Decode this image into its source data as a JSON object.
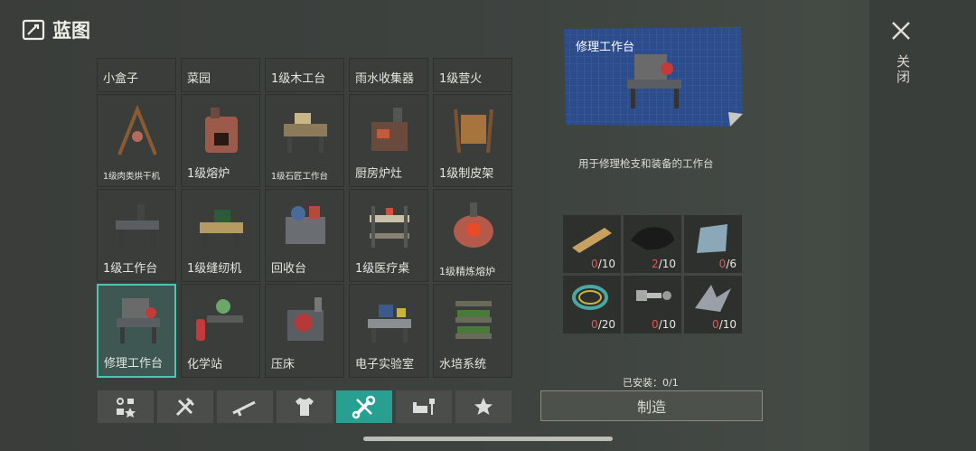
{
  "header": {
    "title": "蓝图"
  },
  "grid": {
    "top_row": [
      "小盒子",
      "菜园",
      "1级木工台",
      "雨水收集器",
      "1级营火"
    ],
    "rows": [
      [
        "1级肉类烘干机",
        "1级熔炉",
        "1级石匠工作台",
        "厨房炉灶",
        "1级制皮架"
      ],
      [
        "1级工作台",
        "1级缝纫机",
        "回收台",
        "1级医疗桌",
        "1级精炼熔炉"
      ],
      [
        "修理工作台",
        "化学站",
        "压床",
        "电子实验室",
        "水培系统"
      ]
    ]
  },
  "tabs": [
    "layout-icon",
    "hammer-wrench-icon",
    "rifle-icon",
    "shirt-icon",
    "wrench-icon",
    "furniture-icon",
    "star-icon"
  ],
  "detail": {
    "title": "修理工作台",
    "description": "用于修理枪支和装备的工作台",
    "materials": [
      {
        "name": "plank-icon",
        "have": "0",
        "need": "/10",
        "have_color": "#e25656"
      },
      {
        "name": "leather-icon",
        "have": "2",
        "need": "/10",
        "have_color": "#e25656"
      },
      {
        "name": "metal-plate-icon",
        "have": "0",
        "need": "/6",
        "have_color": "#e25656"
      },
      {
        "name": "wire-icon",
        "have": "0",
        "need": "/20",
        "have_color": "#e25656"
      },
      {
        "name": "bolt-icon",
        "have": "0",
        "need": "/10",
        "have_color": "#e25656"
      },
      {
        "name": "scrap-metal-icon",
        "have": "0",
        "need": "/10",
        "have_color": "#e25656"
      }
    ],
    "installed": "已安装：0/1",
    "make_label": "制造"
  },
  "close_label": "关闭",
  "colors": {
    "accent": "#28a091",
    "selected_border": "#4fc4b4",
    "missing": "#e25656"
  }
}
